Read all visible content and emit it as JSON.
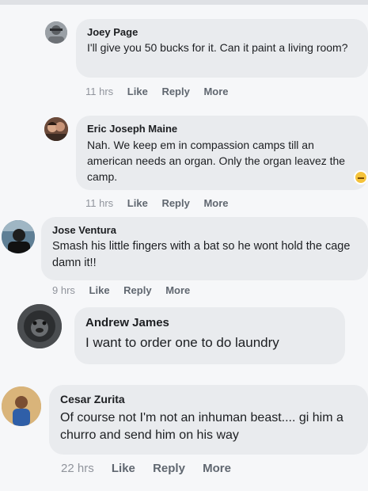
{
  "comments": [
    {
      "name": "Joey Page",
      "text": "I'll give you 50 bucks for it. Can it paint a living room?",
      "time": "11 hrs",
      "like": "Like",
      "reply": "Reply",
      "more": "More"
    },
    {
      "name": "Eric Joseph Maine",
      "text": "Nah. We keep em in compassion camps till an american needs an organ. Only the organ leavez the camp.",
      "time": "11 hrs",
      "like": "Like",
      "reply": "Reply",
      "more": "More"
    },
    {
      "name": "Jose Ventura",
      "text": "Smash his little fingers with a bat so he wont hold the cage damn it!!",
      "time": "9 hrs",
      "like": "Like",
      "reply": "Reply",
      "more": "More"
    },
    {
      "name": "Andrew James",
      "text": "I want to order one to do laundry"
    },
    {
      "name": "Cesar Zurita",
      "text": "Of course not I'm not an inhuman beast.... gi him a churro and send him on his way",
      "time": "22 hrs",
      "like": "Like",
      "reply": "Reply",
      "more": "More"
    }
  ],
  "colors": {
    "bubble": "#e9ebee",
    "action": "#606770",
    "background": "#f6f7f9"
  }
}
